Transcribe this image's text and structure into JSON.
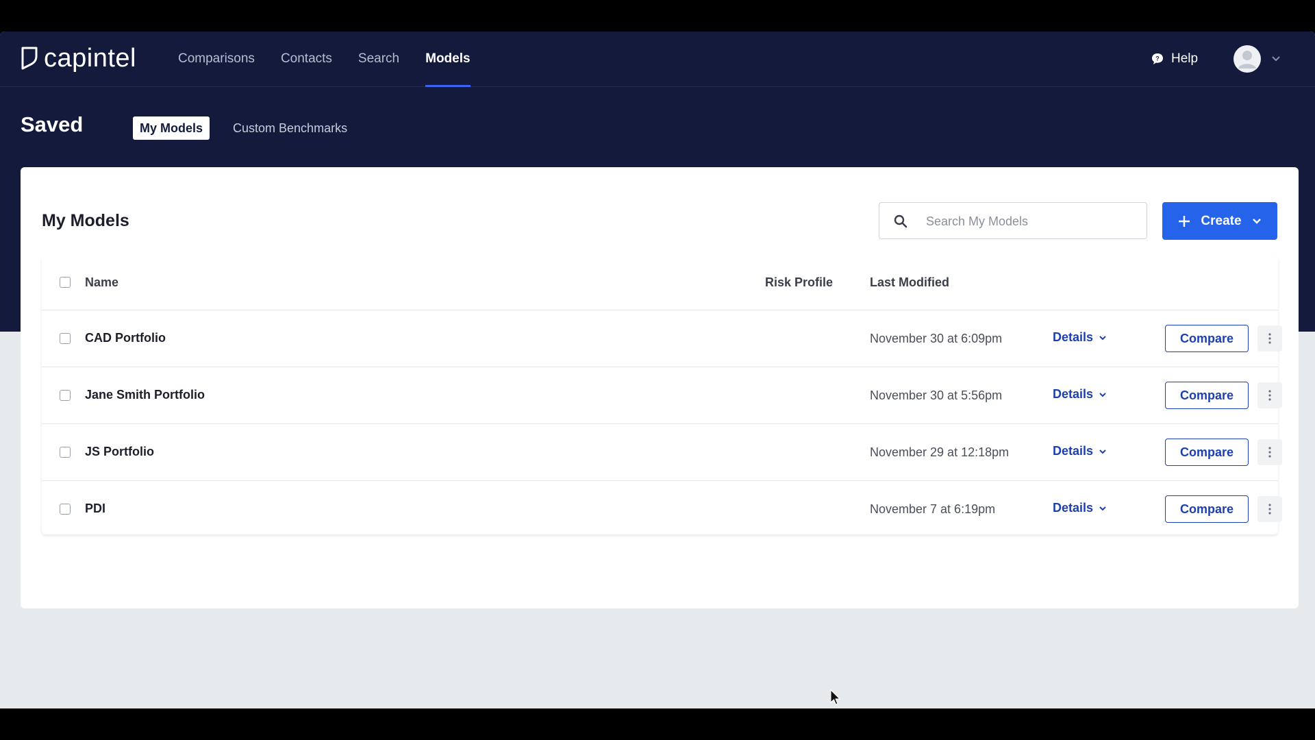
{
  "brand": {
    "name": "capintel"
  },
  "nav": {
    "links": [
      {
        "label": "Comparisons",
        "active": false
      },
      {
        "label": "Contacts",
        "active": false
      },
      {
        "label": "Search",
        "active": false
      },
      {
        "label": "Models",
        "active": true
      }
    ],
    "help_label": "Help"
  },
  "page": {
    "title": "Saved",
    "tabs": [
      {
        "label": "My Models",
        "active": true
      },
      {
        "label": "Custom Benchmarks",
        "active": false
      }
    ]
  },
  "card": {
    "title": "My Models",
    "search": {
      "placeholder": "Search My Models",
      "value": ""
    },
    "create_label": "Create"
  },
  "table": {
    "columns": {
      "name": "Name",
      "risk_profile": "Risk Profile",
      "last_modified": "Last Modified"
    },
    "rows": [
      {
        "name": "CAD Portfolio",
        "risk_profile": "",
        "last_modified": "November 30 at 6:09pm",
        "details_label": "Details",
        "compare_label": "Compare"
      },
      {
        "name": "Jane Smith Portfolio",
        "risk_profile": "",
        "last_modified": "November 30 at 5:56pm",
        "details_label": "Details",
        "compare_label": "Compare"
      },
      {
        "name": "JS Portfolio",
        "risk_profile": "",
        "last_modified": "November 29 at 12:18pm",
        "details_label": "Details",
        "compare_label": "Compare"
      },
      {
        "name": "PDI",
        "risk_profile": "",
        "last_modified": "November 7 at 6:19pm",
        "details_label": "Details",
        "compare_label": "Compare"
      }
    ]
  },
  "colors": {
    "header_bg": "#141a3c",
    "accent": "#2563eb",
    "link": "#1d3fb0",
    "page_bg": "#e7eaed"
  }
}
